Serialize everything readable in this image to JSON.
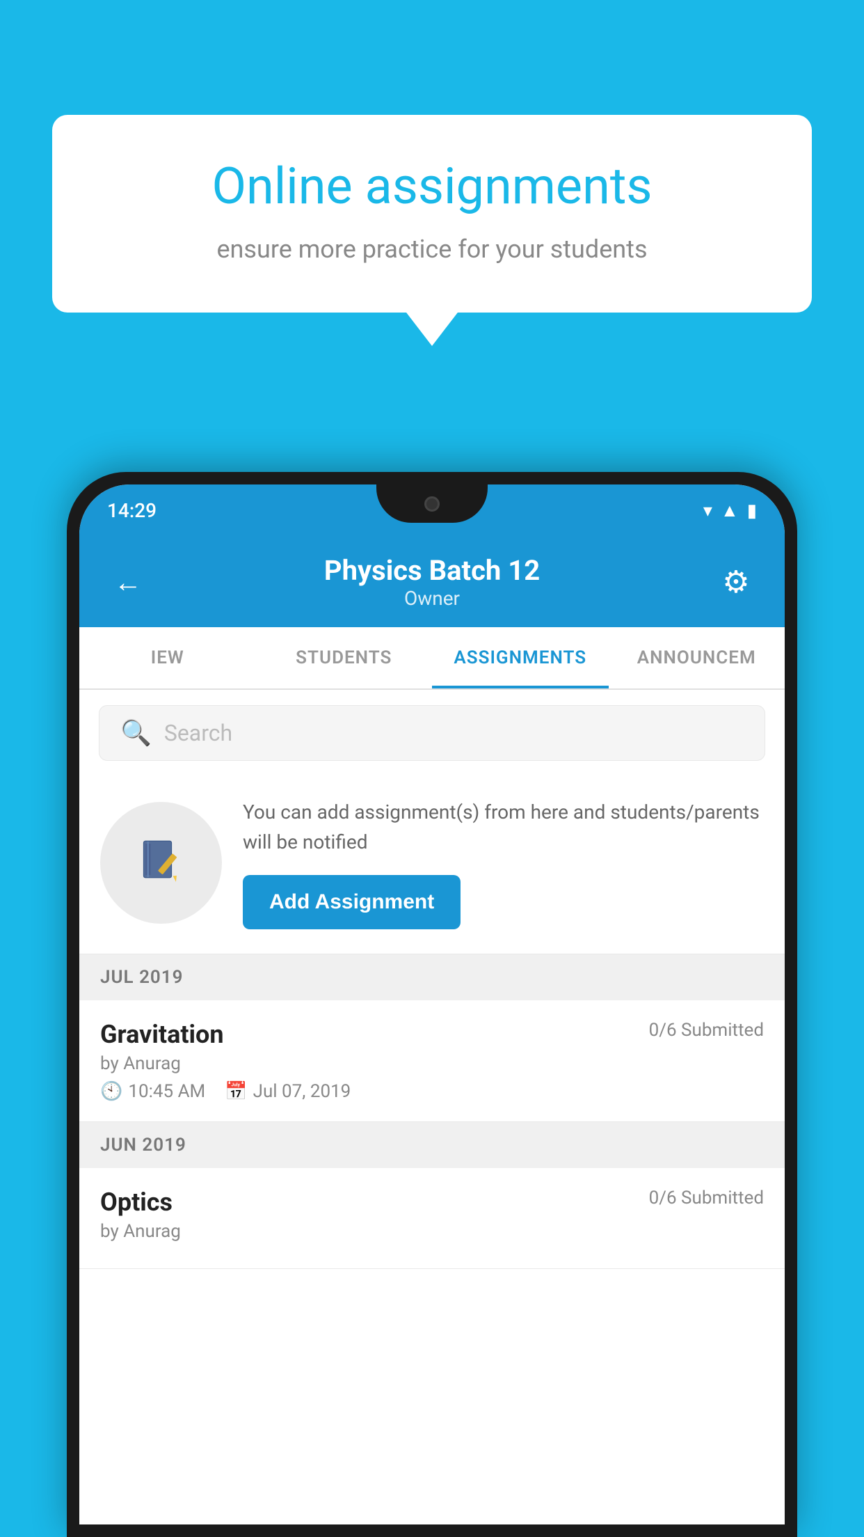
{
  "background_color": "#1ab8e8",
  "speech_bubble": {
    "title": "Online assignments",
    "subtitle": "ensure more practice for your students"
  },
  "phone": {
    "status_bar": {
      "time": "14:29",
      "icons": [
        "wifi",
        "signal",
        "battery"
      ]
    },
    "header": {
      "title": "Physics Batch 12",
      "subtitle": "Owner",
      "back_label": "←",
      "settings_label": "⚙"
    },
    "tabs": [
      {
        "label": "IEW",
        "active": false
      },
      {
        "label": "STUDENTS",
        "active": false
      },
      {
        "label": "ASSIGNMENTS",
        "active": true
      },
      {
        "label": "ANNOUNCEM",
        "active": false
      }
    ],
    "search": {
      "placeholder": "Search"
    },
    "promo": {
      "description": "You can add assignment(s) from here and students/parents will be notified",
      "button_label": "Add Assignment"
    },
    "sections": [
      {
        "month": "JUL 2019",
        "assignments": [
          {
            "title": "Gravitation",
            "submitted": "0/6 Submitted",
            "by": "by Anurag",
            "time": "10:45 AM",
            "date": "Jul 07, 2019"
          }
        ]
      },
      {
        "month": "JUN 2019",
        "assignments": [
          {
            "title": "Optics",
            "submitted": "0/6 Submitted",
            "by": "by Anurag",
            "time": "",
            "date": ""
          }
        ]
      }
    ]
  }
}
